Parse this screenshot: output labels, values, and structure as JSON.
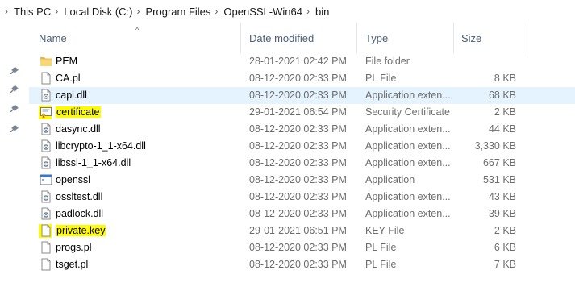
{
  "breadcrumb": [
    "This PC",
    "Local Disk (C:)",
    "Program Files",
    "OpenSSL-Win64",
    "bin"
  ],
  "columns": {
    "name": "Name",
    "date": "Date modified",
    "type": "Type",
    "size": "Size"
  },
  "files": [
    {
      "name": "PEM",
      "date": "28-01-2021 02:42 PM",
      "type": "File folder",
      "size": "",
      "icon": "folder-icon",
      "selected": false,
      "highlight": false
    },
    {
      "name": "CA.pl",
      "date": "08-12-2020 02:33 PM",
      "type": "PL File",
      "size": "8 KB",
      "icon": "file-icon",
      "selected": false,
      "highlight": false
    },
    {
      "name": "capi.dll",
      "date": "08-12-2020 02:33 PM",
      "type": "Application exten...",
      "size": "68 KB",
      "icon": "dll-icon",
      "selected": true,
      "highlight": false
    },
    {
      "name": "certificate",
      "date": "29-01-2021 06:54 PM",
      "type": "Security Certificate",
      "size": "2 KB",
      "icon": "certificate-icon",
      "selected": false,
      "highlight": true
    },
    {
      "name": "dasync.dll",
      "date": "08-12-2020 02:33 PM",
      "type": "Application exten...",
      "size": "44 KB",
      "icon": "dll-icon",
      "selected": false,
      "highlight": false
    },
    {
      "name": "libcrypto-1_1-x64.dll",
      "date": "08-12-2020 02:33 PM",
      "type": "Application exten...",
      "size": "3,330 KB",
      "icon": "dll-icon",
      "selected": false,
      "highlight": false
    },
    {
      "name": "libssl-1_1-x64.dll",
      "date": "08-12-2020 02:33 PM",
      "type": "Application exten...",
      "size": "667 KB",
      "icon": "dll-icon",
      "selected": false,
      "highlight": false
    },
    {
      "name": "openssl",
      "date": "08-12-2020 02:33 PM",
      "type": "Application",
      "size": "531 KB",
      "icon": "application-icon",
      "selected": false,
      "highlight": false
    },
    {
      "name": "ossltest.dll",
      "date": "08-12-2020 02:33 PM",
      "type": "Application exten...",
      "size": "43 KB",
      "icon": "dll-icon",
      "selected": false,
      "highlight": false
    },
    {
      "name": "padlock.dll",
      "date": "08-12-2020 02:33 PM",
      "type": "Application exten...",
      "size": "39 KB",
      "icon": "dll-icon",
      "selected": false,
      "highlight": false
    },
    {
      "name": "private.key",
      "date": "29-01-2021 06:51 PM",
      "type": "KEY File",
      "size": "2 KB",
      "icon": "file-icon",
      "selected": false,
      "highlight": true
    },
    {
      "name": "progs.pl",
      "date": "08-12-2020 02:33 PM",
      "type": "PL File",
      "size": "6 KB",
      "icon": "file-icon",
      "selected": false,
      "highlight": false
    },
    {
      "name": "tsget.pl",
      "date": "08-12-2020 02:33 PM",
      "type": "PL File",
      "size": "7 KB",
      "icon": "file-icon",
      "selected": false,
      "highlight": false
    }
  ],
  "colors": {
    "selected_row": "#e5f3ff",
    "highlight": "#fffc00",
    "header_text": "#4c607a"
  }
}
